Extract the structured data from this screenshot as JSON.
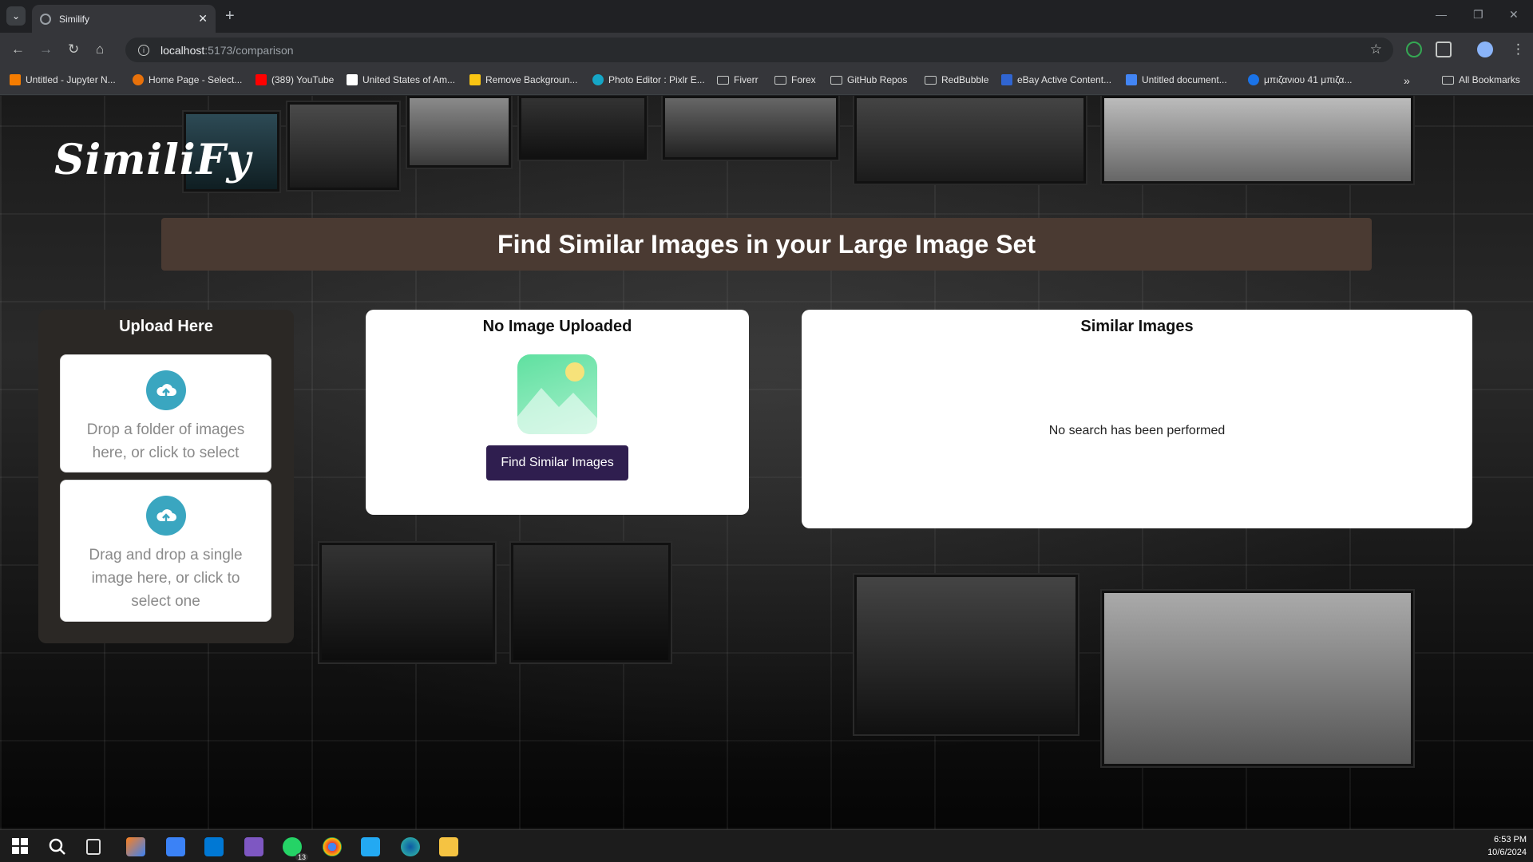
{
  "browser": {
    "tab_title": "Similify",
    "url_host": "localhost",
    "url_path": ":5173/comparison",
    "bookmarks": [
      {
        "label": "Untitled - Jupyter N...",
        "color": "#f57c00"
      },
      {
        "label": "Home Page - Select...",
        "color": "#e8710a"
      },
      {
        "label": "(389) YouTube",
        "color": "#ff0000"
      },
      {
        "label": "United States of Am...",
        "color": "#ffffff"
      },
      {
        "label": "Remove Backgroun...",
        "color": "#f9c513"
      },
      {
        "label": "Photo Editor : Pixlr E...",
        "color": "#15a6c6"
      },
      {
        "label": "Fiverr",
        "folder": true
      },
      {
        "label": "Forex",
        "folder": true
      },
      {
        "label": "GitHub Repos",
        "folder": true
      },
      {
        "label": "RedBubble",
        "folder": true
      },
      {
        "label": "eBay Active Content...",
        "color": "#3065d1"
      },
      {
        "label": "Untitled document...",
        "color": "#4285f4"
      },
      {
        "label": "μπιζανιου 41 μπιζα...",
        "color": "#1a73e8"
      }
    ],
    "all_bookmarks": "All Bookmarks"
  },
  "app": {
    "logo": "SimiliFy",
    "banner_title": "Find Similar Images in your Large Image Set",
    "upload_heading": "Upload Here",
    "folder_drop_text": "Drop a folder of images here, or click to select",
    "single_drop_text": "Drag and drop a single image here, or click to select one",
    "preview_heading": "No Image Uploaded",
    "find_button": "Find Similar Images",
    "results_heading": "Similar Images",
    "results_empty": "No search has been performed"
  },
  "taskbar": {
    "whatsapp_badge": "13",
    "time": "6:53 PM",
    "date": "10/6/2024"
  },
  "colors": {
    "banner_bg": "#4a3a32",
    "upload_panel_bg": "#2b2825",
    "button_bg": "#2f1e4f",
    "cloud_icon": "#3aa6c0",
    "image_icon": "#5fe0a0"
  }
}
